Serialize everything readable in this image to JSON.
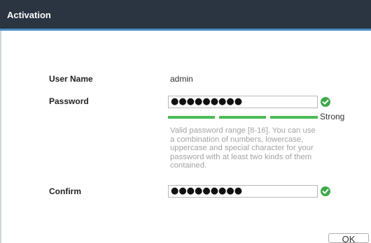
{
  "dialog": {
    "title": "Activation"
  },
  "form": {
    "username_label": "User Name",
    "username_value": "admin",
    "password_label": "Password",
    "password_value": "●●●●●●●●●",
    "strength": {
      "label": "Strong",
      "filled_segments": 3,
      "total_segments": 3,
      "color": "#4cbb55"
    },
    "hint": "Valid password range [8-16]. You can use a combination of numbers, lowercase, uppercase and special character for your password with at least two kinds of them contained.",
    "confirm_label": "Confirm",
    "confirm_value": "●●●●●●●●●"
  },
  "buttons": {
    "ok_label": "OK"
  },
  "colors": {
    "titlebar": "#2b3441",
    "titlebar_accent": "#4a8fc7",
    "valid": "#3da84a"
  },
  "icons": {
    "password_valid": "check-circle-icon",
    "confirm_valid": "check-circle-icon"
  }
}
